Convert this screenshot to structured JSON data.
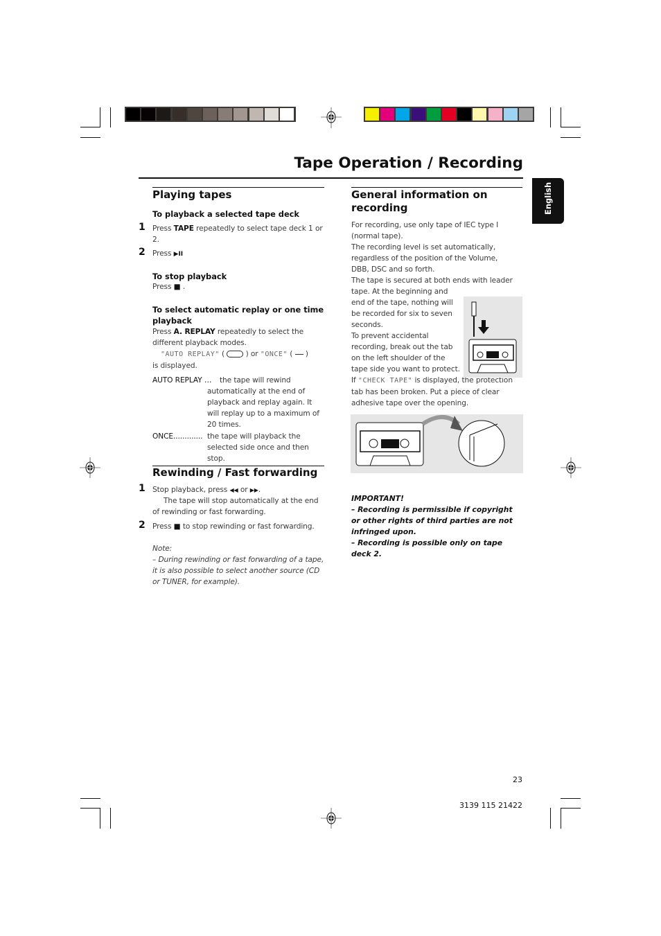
{
  "header": {
    "title": "Tape Operation / Recording",
    "language_tab": "English"
  },
  "colors": {
    "gray_bar": [
      "#000000",
      "#050304",
      "#1d1916",
      "#372d29",
      "#4f4640",
      "#6b615a",
      "#877c76",
      "#a29690",
      "#c0b7b1",
      "#e0dcd8",
      "#ffffff"
    ],
    "color_bar": [
      "#f7ef00",
      "#e4007c",
      "#00a6e8",
      "#3b0f7a",
      "#009d3e",
      "#e20025",
      "#000000",
      "#fff7ae",
      "#f5b1c8",
      "#9ed4f2",
      "#a5a5a5"
    ]
  },
  "left": {
    "playing": {
      "heading": "Playing tapes",
      "sub1": "To playback a selected tape deck",
      "step1_num": "1",
      "step1_a": "Press ",
      "step1_b": "TAPE",
      "step1_c": " repeatedly to select tape deck 1 or 2.",
      "step2_num": "2",
      "step2_a": "Press ",
      "step2_icon": "▶II",
      "sub2": "To stop playback",
      "stop_a": "Press ",
      "stop_icon": "■",
      "stop_c": " .",
      "sub3": "To select automatic replay or one time playback",
      "replay_a": "Press ",
      "replay_b": "A. REPLAY",
      "replay_c": " repeatedly to select the different playback modes.",
      "disp_1": "\"AUTO REPLAY\"",
      "disp_2": " ( ",
      "disp_3": " ) or ",
      "disp_4": "\"ONCE\"",
      "disp_5": " ( ",
      "disp_6": " )",
      "disp_7": "is displayed.",
      "auto_term": "AUTO REPLAY",
      "auto_dots": " …",
      "auto_desc": "the tape will rewind automatically at the end of playback and replay again. It will replay up to a maximum of 20 times.",
      "once_term": "ONCE",
      "once_dots": ".............",
      "once_desc": "the tape will playback the selected side once and then stop."
    },
    "rewind": {
      "heading": "Rewinding / Fast forwarding",
      "step1_num": "1",
      "step1_a": "Stop playback, press ",
      "step1_icon1": "◀◀",
      "step1_or": " or ",
      "step1_icon2": "▶▶",
      "step1_end": ".",
      "step1_note": "The tape will stop automatically at the end of rewinding or fast forwarding.",
      "step2_num": "2",
      "step2_a": "Press ",
      "step2_icon": "■",
      "step2_c": "  to stop rewinding or fast forwarding.",
      "note_label": "Note:",
      "note_text": "–  During rewinding or fast forwarding of a tape, it is also possible to select another source (CD or TUNER, for example)."
    }
  },
  "right": {
    "heading": "General information on recording",
    "p1": "For recording, use only tape of IEC type I (normal tape).",
    "p2": "The recording level is set automatically, regardless of the position of the Volume, DBB, DSC and so forth.",
    "p3_line1": "The tape is secured at both ends with leader",
    "p3_rest": "tape.  At the beginning and end of the tape, nothing will be recorded for six to seven seconds.",
    "p4": "To prevent accidental recording, break out the tab on the left shoulder of the tape side you want to protect.",
    "p5_a": "If ",
    "p5_lcd": "\"CHECK  TAPE\"",
    "p5_b": " is displayed, the protection tab has been broken.  Put a piece of clear adhesive tape over the opening.",
    "important_label": "IMPORTANT!",
    "important_1": "–  Recording is permissible if copyright or other rights of third parties are not infringed upon.",
    "important_2": "–  Recording is possible only on tape deck 2."
  },
  "footer": {
    "page_number": "23",
    "doc_code": "3139 115 21422"
  }
}
